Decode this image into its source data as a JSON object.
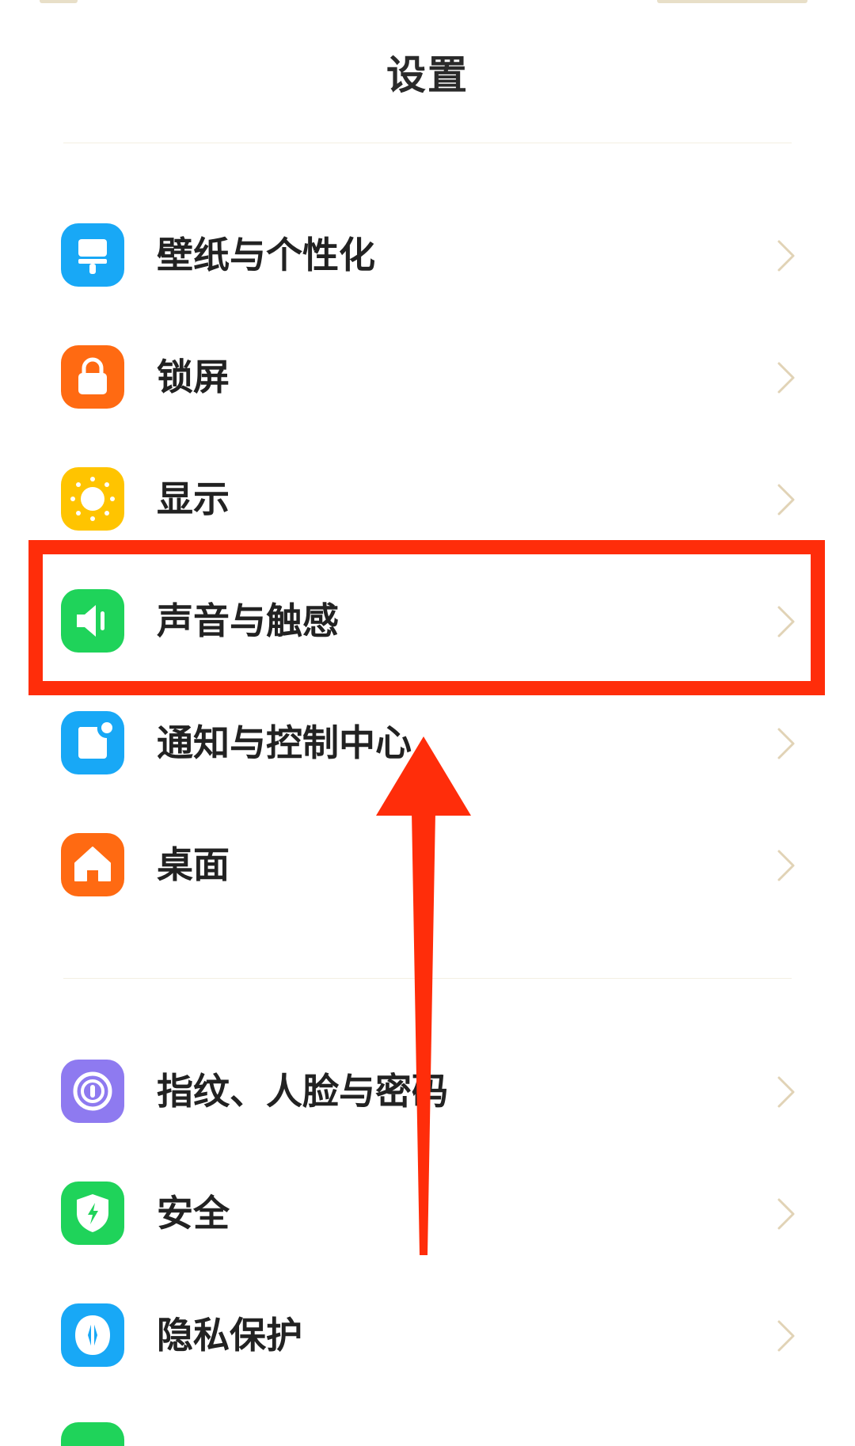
{
  "page": {
    "title": "设置",
    "accent_red": "#ff2d0a"
  },
  "settings_groups": [
    {
      "items": [
        {
          "label": "壁纸与个性化",
          "icon": "wallpaper-brush-icon",
          "color": "#18a8f6"
        },
        {
          "label": "锁屏",
          "icon": "lock-icon",
          "color": "#ff6a12"
        },
        {
          "label": "显示",
          "icon": "sun-display-icon",
          "color": "#ffc400"
        },
        {
          "label": "声音与触感",
          "icon": "speaker-icon",
          "color": "#1fd35a",
          "highlighted": true
        },
        {
          "label": "通知与控制中心",
          "icon": "notification-icon",
          "color": "#18a8f6"
        },
        {
          "label": "桌面",
          "icon": "home-icon",
          "color": "#ff6a12"
        }
      ]
    },
    {
      "items": [
        {
          "label": "指纹、人脸与密码",
          "icon": "fingerprint-icon",
          "color": "#8e7af0"
        },
        {
          "label": "安全",
          "icon": "shield-icon",
          "color": "#1fd35a"
        },
        {
          "label": "隐私保护",
          "icon": "privacy-icon",
          "color": "#18a8f6"
        }
      ]
    }
  ],
  "annotations": {
    "highlight_target": "声音与触感",
    "arrow_direction": "up"
  }
}
